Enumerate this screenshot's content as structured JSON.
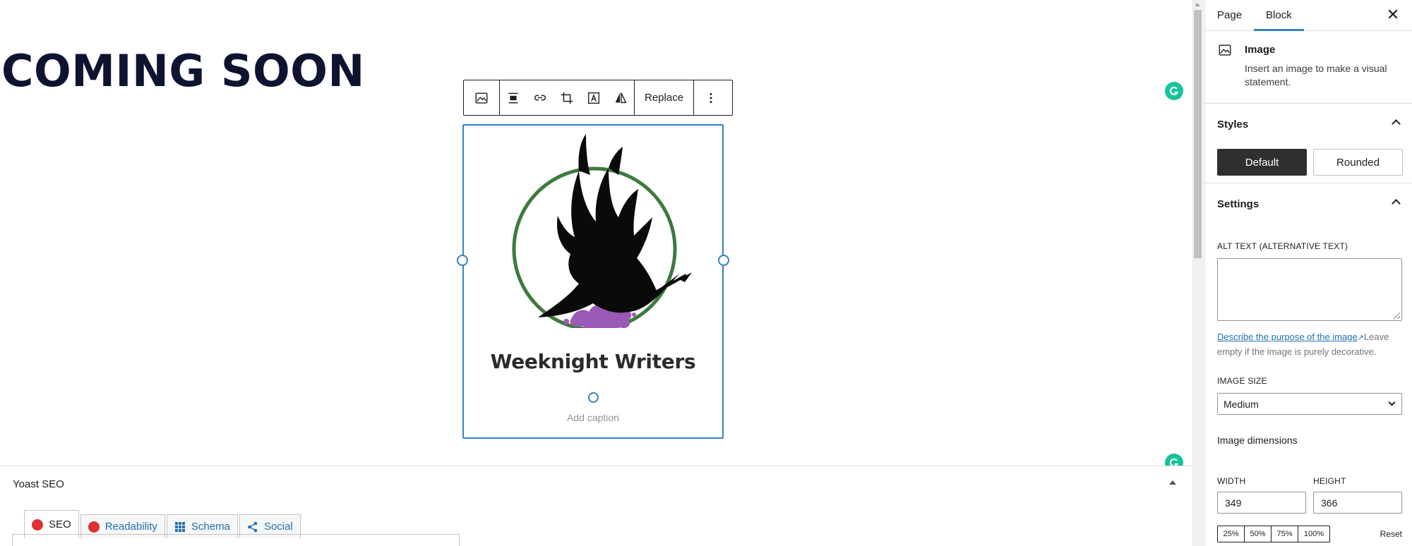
{
  "canvas": {
    "heading": "COMING SOON",
    "image_block": {
      "logo_text": "Weeknight Writers",
      "caption_placeholder": "Add caption"
    },
    "toolbar": {
      "replace_label": "Replace",
      "icons": [
        "image-icon",
        "align-icon",
        "link-icon",
        "crop-icon",
        "text-overlay-icon",
        "flip-icon",
        "more-options-icon"
      ]
    }
  },
  "yoast": {
    "title": "Yoast SEO",
    "tabs": [
      {
        "label": "SEO",
        "icon": "red-dot-icon",
        "active": true
      },
      {
        "label": "Readability",
        "icon": "red-dot-icon",
        "active": false
      },
      {
        "label": "Schema",
        "icon": "grid-icon",
        "active": false
      },
      {
        "label": "Social",
        "icon": "share-icon",
        "active": false
      }
    ]
  },
  "sidebar": {
    "tabs": [
      "Page",
      "Block"
    ],
    "active_tab": "Block",
    "close_icon": "close-icon",
    "block": {
      "name": "Image",
      "description": "Insert an image to make a visual statement."
    },
    "styles": {
      "heading": "Styles",
      "options": [
        "Default",
        "Rounded"
      ],
      "selected": "Default"
    },
    "settings": {
      "heading": "Settings",
      "alt_label": "ALT TEXT (ALTERNATIVE TEXT)",
      "alt_value": "",
      "alt_link": "Describe the purpose of the image",
      "alt_help": "Leave empty if the image is purely decorative.",
      "image_size_label": "IMAGE SIZE",
      "image_size_value": "Medium",
      "dimensions_heading": "Image dimensions",
      "width_label": "WIDTH",
      "height_label": "HEIGHT",
      "width_value": "349",
      "height_value": "366",
      "percent_options": [
        "25%",
        "50%",
        "75%",
        "100%"
      ],
      "reset_label": "Reset"
    }
  },
  "colors": {
    "accent": "#3582c4",
    "heading": "#0e1430",
    "grammarly": "#15c39a",
    "yoast_red": "#dc3232",
    "logo_ring": "#3d7a3d",
    "ink_splash": "#9b59b6"
  }
}
